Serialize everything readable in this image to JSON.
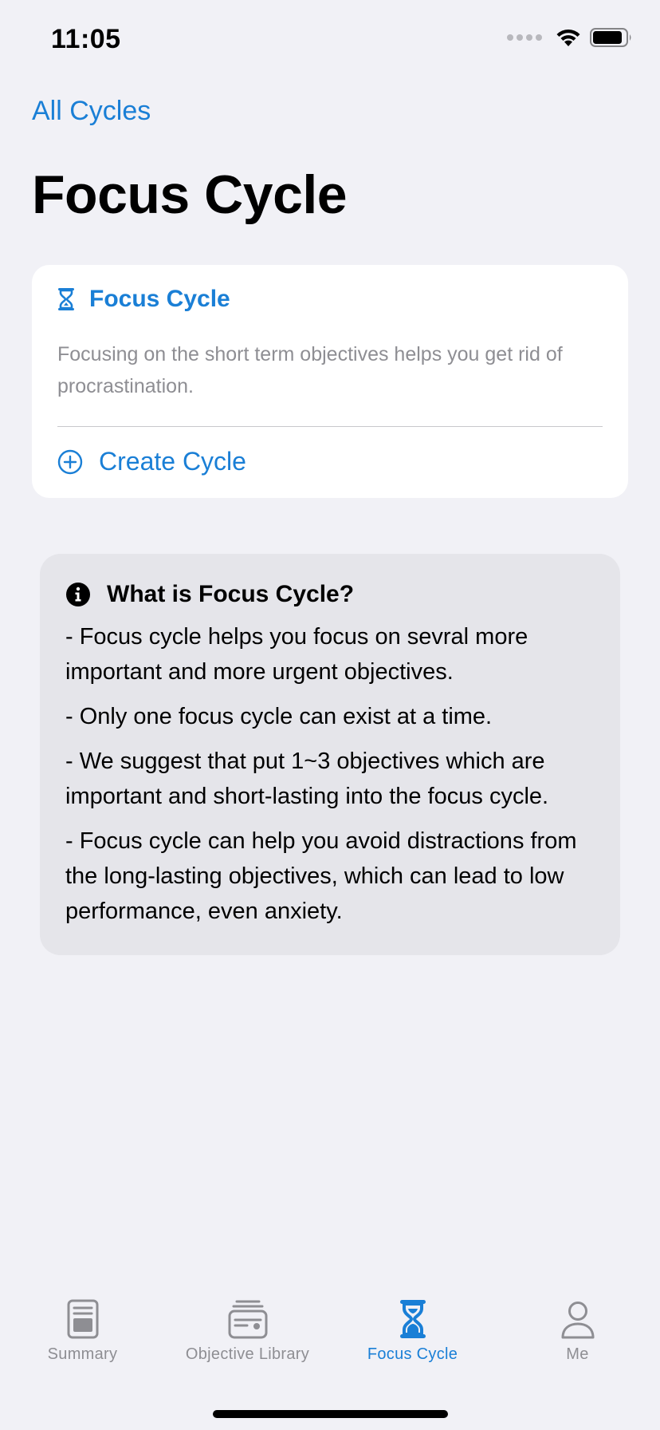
{
  "status_bar": {
    "time": "11:05"
  },
  "nav": {
    "back_label": "All Cycles",
    "title": "Focus Cycle"
  },
  "card": {
    "header_label": "Focus Cycle",
    "description": "Focusing on the short term objectives helps you get rid of procrastination.",
    "create_label": "Create Cycle",
    "icon": "hourglass-icon"
  },
  "info": {
    "icon": "info-circle-icon",
    "title": "What is Focus Cycle?",
    "paragraphs": [
      "- Focus cycle helps you focus on sevral more important and more urgent objectives.",
      "- Only one focus cycle can exist at a time.",
      "- We suggest that put 1~3 objectives which are important and short-lasting into the focus cycle.",
      "- Focus cycle can help you avoid distractions from the long-lasting objectives, which can lead to low performance, even anxiety."
    ]
  },
  "tabs": [
    {
      "label": "Summary",
      "icon": "summary-icon",
      "active": false
    },
    {
      "label": "Objective Library",
      "icon": "library-icon",
      "active": false
    },
    {
      "label": "Focus Cycle",
      "icon": "hourglass-icon",
      "active": true
    },
    {
      "label": "Me",
      "icon": "person-icon",
      "active": false
    }
  ],
  "colors": {
    "accent": "#1a7fd6",
    "background": "#f1f1f6",
    "card": "#ffffff",
    "info_box": "#e5e5ea",
    "secondary_text": "#8e8e93"
  }
}
